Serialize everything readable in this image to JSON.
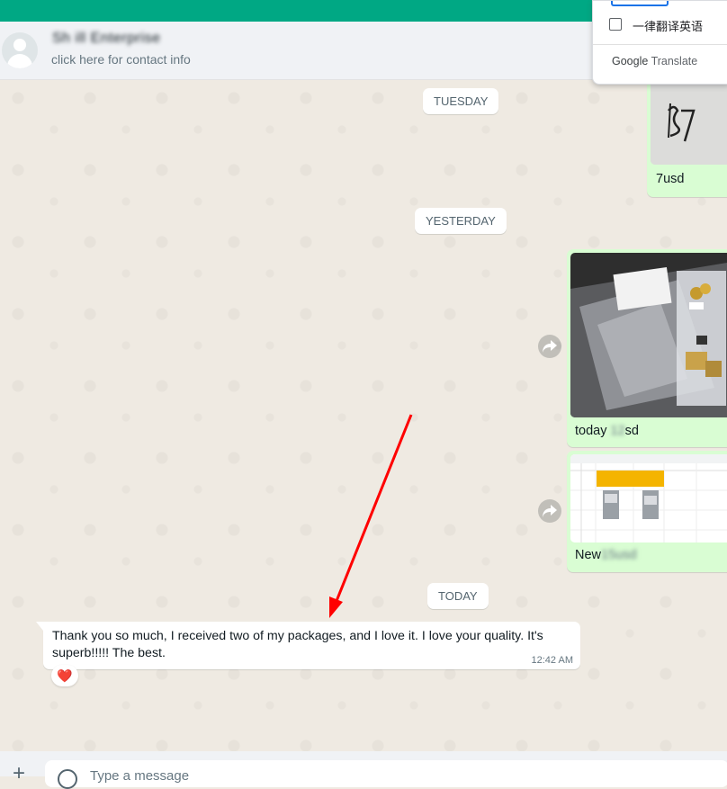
{
  "header": {
    "contact_name": "Sh ill Enterprise",
    "contact_subtitle": "click here for contact info"
  },
  "dates": {
    "tuesday": "TUESDAY",
    "yesterday": "YESTERDAY",
    "today": "TODAY"
  },
  "messages": {
    "outgoing_1": {
      "caption": "7usd"
    },
    "outgoing_2": {
      "caption_prefix": "today ",
      "caption_blurred": "12 ",
      "caption_suffix": "sd"
    },
    "outgoing_3": {
      "caption_prefix": "New",
      "caption_blurred": "15usd"
    },
    "incoming_1": {
      "text": "Thank you so much, I received two of my packages, and I love it. I love your quality. It's superb!!!!! The best.",
      "time": "12:42 AM",
      "reaction": "❤️"
    }
  },
  "composer": {
    "placeholder": "Type a message"
  },
  "translate_popup": {
    "checkbox_label": "一律翻译英语",
    "brand_google": "Google",
    "brand_translate": "Translate"
  },
  "icons": {
    "forward": "forward-icon",
    "emoji": "emoji-icon",
    "attach": "plus-icon",
    "avatar": "default-avatar-icon"
  },
  "colors": {
    "topbar": "#00a884",
    "outgoing_bubble": "#d9fdd3",
    "incoming_bubble": "#ffffff",
    "chat_background": "#efeae2",
    "annotation_arrow": "#ff0000"
  }
}
